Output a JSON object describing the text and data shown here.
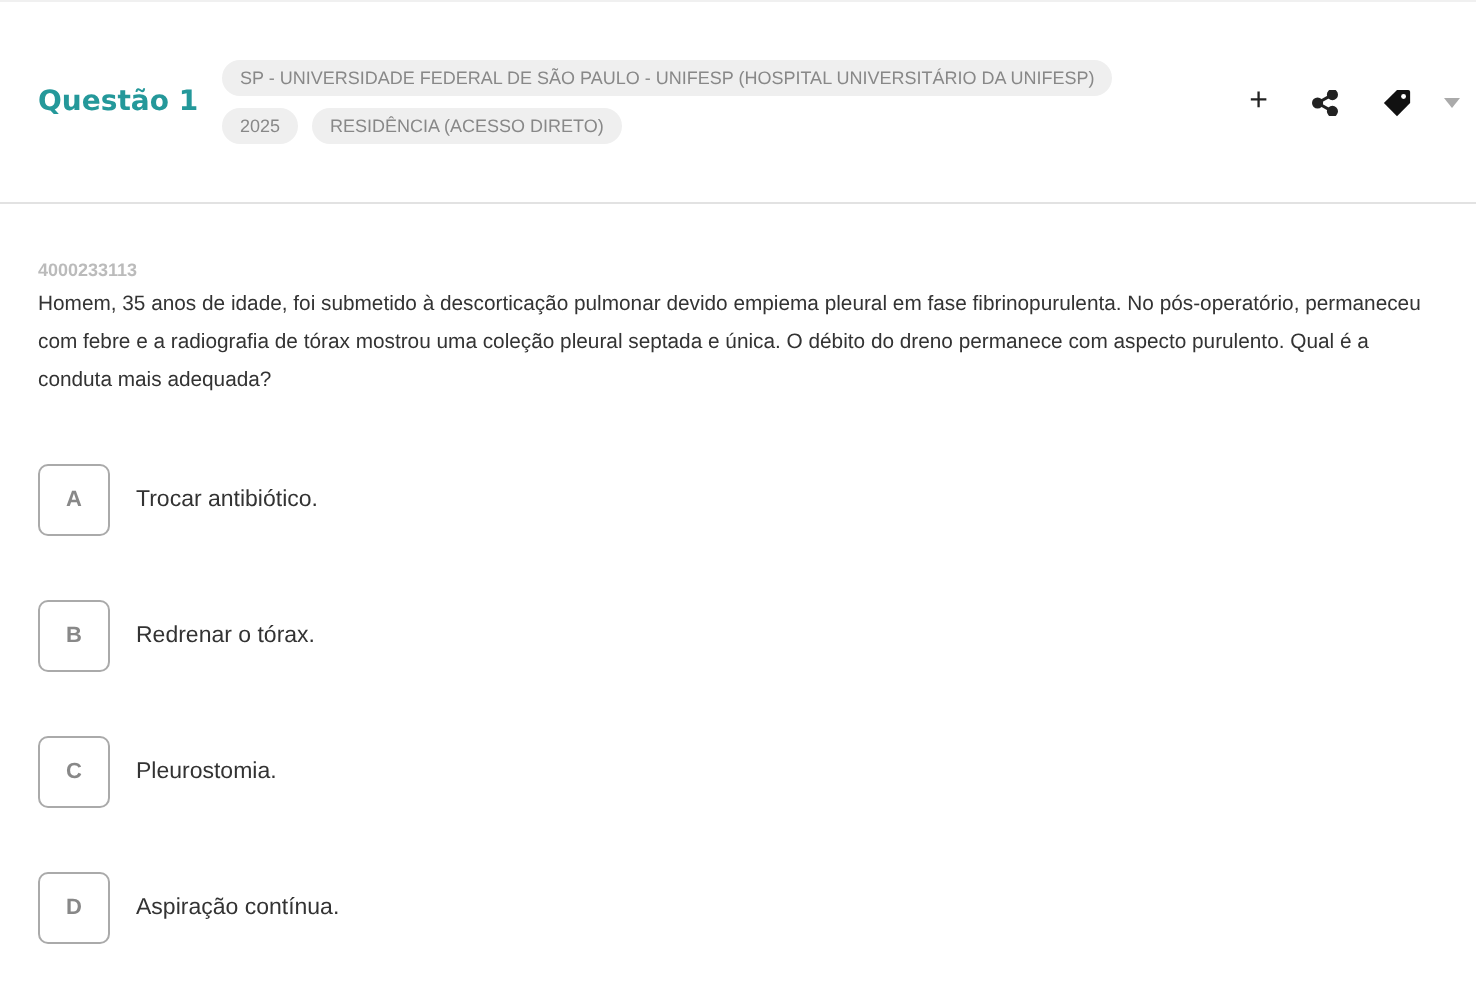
{
  "header": {
    "title": "Questão 1",
    "tags": [
      [
        "SP - UNIVERSIDADE FEDERAL DE SÃO PAULO - UNIFESP (HOSPITAL UNIVERSITÁRIO DA UNIFESP)"
      ],
      [
        "2025",
        "RESIDÊNCIA (ACESSO DIRETO)"
      ]
    ],
    "actions": [
      "+"
    ]
  },
  "question": {
    "id": "4000233113",
    "text": "Homem, 35 anos de idade, foi submetido à descorticação pulmonar devido empiema pleural em fase fibrinopurulenta. No pós-operatório, permaneceu com febre e a radiografia de tórax mostrou uma coleção pleural septada e única. O débito do dreno permanece com aspecto purulento. Qual é a conduta mais adequada?"
  },
  "options": [
    {
      "letter": "A",
      "text": "Trocar antibiótico."
    },
    {
      "letter": "B",
      "text": "Redrenar o tórax."
    },
    {
      "letter": "C",
      "text": "Pleurostomia."
    },
    {
      "letter": "D",
      "text": "Aspiração contínua."
    }
  ]
}
